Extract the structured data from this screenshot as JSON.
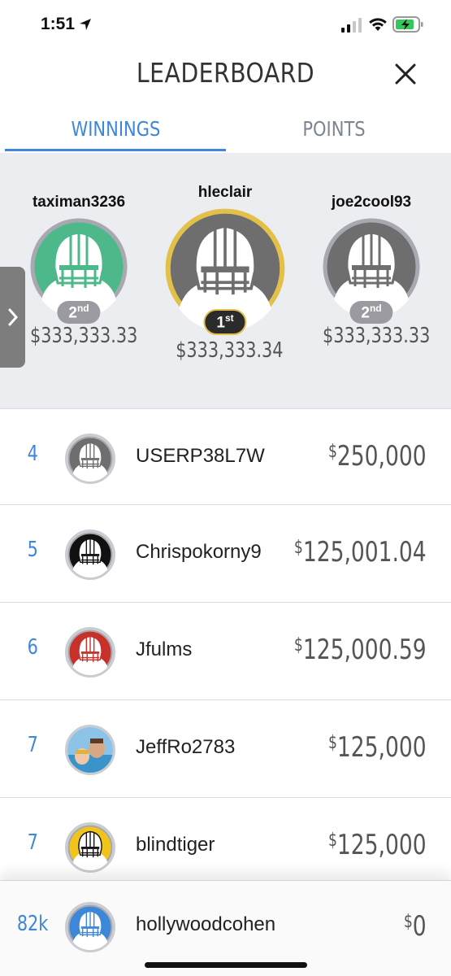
{
  "status_bar": {
    "time": "1:51"
  },
  "header": {
    "title": "LEADERBOARD"
  },
  "tabs": [
    {
      "label": "WINNINGS",
      "active": true
    },
    {
      "label": "POINTS",
      "active": false
    }
  ],
  "podium": {
    "left": {
      "name": "taximan3236",
      "rank": "2",
      "rank_suffix": "nd",
      "amount": "$333,333.33",
      "avatar_color": "#4db88a"
    },
    "center": {
      "name": "hleclair",
      "rank": "1",
      "rank_suffix": "st",
      "amount": "$333,333.34",
      "avatar_color": "#6e6e6e"
    },
    "right": {
      "name": "joe2cool93",
      "rank": "2",
      "rank_suffix": "nd",
      "amount": "$333,333.33",
      "avatar_color": "#6e6e6e"
    }
  },
  "leaderboard": [
    {
      "rank": "4",
      "name": "USERP38L7W",
      "currency": "$",
      "amount": "250,000",
      "avatar": "helmet-gray-icon",
      "avatar_color": "#6e6e6e"
    },
    {
      "rank": "5",
      "name": "Chrispokorny9",
      "currency": "$",
      "amount": "125,001.04",
      "avatar": "helmet-black-icon",
      "avatar_color": "#111111"
    },
    {
      "rank": "6",
      "name": "Jfulms",
      "currency": "$",
      "amount": "125,000.59",
      "avatar": "helmet-red-icon",
      "avatar_color": "#c8312a"
    },
    {
      "rank": "7",
      "name": "JeffRo2783",
      "currency": "$",
      "amount": "125,000",
      "avatar": "user-photo",
      "avatar_color": "#7fb6d9"
    },
    {
      "rank": "7",
      "name": "blindtiger",
      "currency": "$",
      "amount": "125,000",
      "avatar": "helmet-yellow-icon",
      "avatar_color": "#f0c419"
    }
  ],
  "current_user": {
    "rank": "82k",
    "name": "hollywoodcohen",
    "currency": "$",
    "amount": "0",
    "avatar": "helmet-blue-icon",
    "avatar_color": "#3d87d8"
  },
  "colors": {
    "accent": "#3d87d8",
    "gold": "#e2c04a",
    "podium_bg": "#ebedf0"
  }
}
